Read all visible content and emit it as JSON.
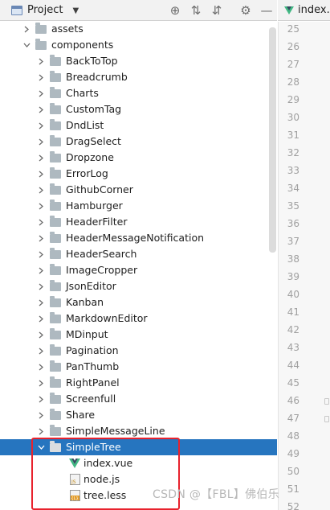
{
  "panel": {
    "title": "Project",
    "tools": [
      {
        "name": "locate-icon",
        "glyph": "⊕"
      },
      {
        "name": "expand-all-icon",
        "glyph": "⇅"
      },
      {
        "name": "collapse-all-icon",
        "glyph": "⇵"
      },
      {
        "name": "settings-icon",
        "glyph": "⚙"
      },
      {
        "name": "hide-icon",
        "glyph": "—"
      }
    ]
  },
  "editor": {
    "tab_label": "index.v",
    "line_numbers": [
      "25",
      "26",
      "27",
      "28",
      "29",
      "30",
      "31",
      "32",
      "33",
      "34",
      "35",
      "36",
      "37",
      "38",
      "39",
      "40",
      "41",
      "42",
      "43",
      "44",
      "45",
      "46",
      "47",
      "48",
      "49",
      "50",
      "51",
      "52"
    ]
  },
  "tree": {
    "items": [
      {
        "label": "assets",
        "type": "folder",
        "state": "collapsed",
        "depth": 1
      },
      {
        "label": "components",
        "type": "folder",
        "state": "expanded",
        "depth": 1
      },
      {
        "label": "BackToTop",
        "type": "folder",
        "state": "collapsed",
        "depth": 2
      },
      {
        "label": "Breadcrumb",
        "type": "folder",
        "state": "collapsed",
        "depth": 2
      },
      {
        "label": "Charts",
        "type": "folder",
        "state": "collapsed",
        "depth": 2
      },
      {
        "label": "CustomTag",
        "type": "folder",
        "state": "collapsed",
        "depth": 2
      },
      {
        "label": "DndList",
        "type": "folder",
        "state": "collapsed",
        "depth": 2
      },
      {
        "label": "DragSelect",
        "type": "folder",
        "state": "collapsed",
        "depth": 2
      },
      {
        "label": "Dropzone",
        "type": "folder",
        "state": "collapsed",
        "depth": 2
      },
      {
        "label": "ErrorLog",
        "type": "folder",
        "state": "collapsed",
        "depth": 2
      },
      {
        "label": "GithubCorner",
        "type": "folder",
        "state": "collapsed",
        "depth": 2
      },
      {
        "label": "Hamburger",
        "type": "folder",
        "state": "collapsed",
        "depth": 2
      },
      {
        "label": "HeaderFilter",
        "type": "folder",
        "state": "collapsed",
        "depth": 2
      },
      {
        "label": "HeaderMessageNotification",
        "type": "folder",
        "state": "collapsed",
        "depth": 2
      },
      {
        "label": "HeaderSearch",
        "type": "folder",
        "state": "collapsed",
        "depth": 2
      },
      {
        "label": "ImageCropper",
        "type": "folder",
        "state": "collapsed",
        "depth": 2
      },
      {
        "label": "JsonEditor",
        "type": "folder",
        "state": "collapsed",
        "depth": 2
      },
      {
        "label": "Kanban",
        "type": "folder",
        "state": "collapsed",
        "depth": 2
      },
      {
        "label": "MarkdownEditor",
        "type": "folder",
        "state": "collapsed",
        "depth": 2
      },
      {
        "label": "MDinput",
        "type": "folder",
        "state": "collapsed",
        "depth": 2
      },
      {
        "label": "Pagination",
        "type": "folder",
        "state": "collapsed",
        "depth": 2
      },
      {
        "label": "PanThumb",
        "type": "folder",
        "state": "collapsed",
        "depth": 2
      },
      {
        "label": "RightPanel",
        "type": "folder",
        "state": "collapsed",
        "depth": 2
      },
      {
        "label": "Screenfull",
        "type": "folder",
        "state": "collapsed",
        "depth": 2
      },
      {
        "label": "Share",
        "type": "folder",
        "state": "collapsed",
        "depth": 2
      },
      {
        "label": "SimpleMessageLine",
        "type": "folder",
        "state": "collapsed",
        "depth": 2
      },
      {
        "label": "SimpleTree",
        "type": "folder",
        "state": "expanded",
        "depth": 2,
        "selected": true
      },
      {
        "label": "index.vue",
        "type": "vue",
        "depth": 3
      },
      {
        "label": "node.js",
        "type": "js",
        "depth": 3
      },
      {
        "label": "tree.less",
        "type": "less",
        "depth": 3
      }
    ]
  },
  "watermark": "CSDN @【FBL】佛伯乐",
  "colors": {
    "selection": "#2675bf",
    "folder": "#aeb9c0",
    "highlight_box": "#e8222d",
    "vue_green": "#41b883"
  }
}
